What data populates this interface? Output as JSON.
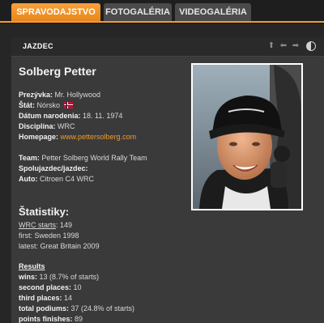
{
  "tabs": [
    {
      "label": "SPRAVODAJSTVO",
      "active": true
    },
    {
      "label": "FOTOGALÉRIA",
      "active": false
    },
    {
      "label": "VIDEOGALÉRIA",
      "active": false
    }
  ],
  "colors": {
    "accent": "#f39a2c",
    "panel": "#3a3a3a",
    "background": "#262626"
  },
  "panel": {
    "title": "JAZDEC",
    "icons": [
      "arrow-up-icon",
      "arrow-left-icon",
      "arrow-right-icon",
      "contrast-icon"
    ]
  },
  "driver": {
    "name": "Solberg Petter",
    "nickname_label": "Prezývka:",
    "nickname": "Mr. Hollywood",
    "country_label": "Štát:",
    "country": "Nórsko",
    "birth_label": "Dátum narodenia:",
    "birth": "18. 11. 1974",
    "discipline_label": "Disciplína:",
    "discipline": "WRC",
    "homepage_label": "Homepage:",
    "homepage": "www.pettersolberg.com",
    "team_label": "Team:",
    "team": "Petter Solberg World Rally Team",
    "codriver_label": "Spolujazdec/jazdec:",
    "car_label": "Auto:",
    "car": "Citroen C4 WRC"
  },
  "stats": {
    "title": "Štatistiky:",
    "wrc_starts_label": "WRC starts",
    "wrc_starts": "149",
    "first_label": "first:",
    "first": "Sweden 1998",
    "latest_label": "latest:",
    "latest": "Great Britain 2009",
    "results_label": "Results",
    "wins_label": "wins:",
    "wins": "13 (8.7% of starts)",
    "second_label": "second places:",
    "second": "10",
    "third_label": "third places:",
    "third": "14",
    "podiums_label": "total podiums:",
    "podiums": "37 (24.8% of starts)",
    "points_label": "points finishes:",
    "points": "89"
  }
}
